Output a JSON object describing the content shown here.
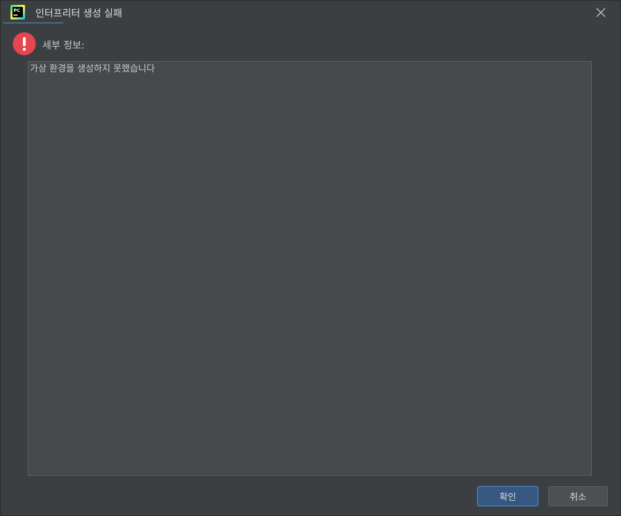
{
  "window": {
    "title": "인터프리터 생성 실패"
  },
  "header": {
    "label": "세부 정보:"
  },
  "details": {
    "text": "가상 환경을 생성하지 못했습니다"
  },
  "buttons": {
    "ok_label": "확인",
    "cancel_label": "취소"
  },
  "icons": {
    "app": "pycharm-icon",
    "close": "close-icon",
    "error": "error-icon"
  },
  "colors": {
    "background": "#3c3f41",
    "text_area": "#45494a",
    "primary_button": "#365880",
    "error_red": "#e5464f"
  }
}
